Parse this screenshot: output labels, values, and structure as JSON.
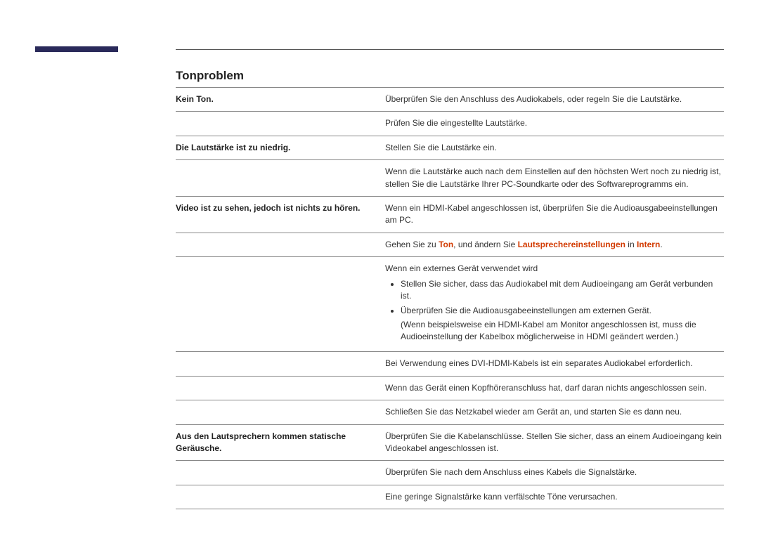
{
  "heading": "Tonproblem",
  "rows": [
    {
      "label": "Kein Ton.",
      "value": "Überprüfen Sie den Anschluss des Audiokabels, oder regeln Sie die Lautstärke."
    },
    {
      "label": "",
      "value": "Prüfen Sie die eingestellte Lautstärke."
    },
    {
      "label": "Die Lautstärke ist zu niedrig.",
      "value": "Stellen Sie die Lautstärke ein."
    },
    {
      "label": "",
      "value": "Wenn die Lautstärke auch nach dem Einstellen auf den höchsten Wert noch zu niedrig ist, stellen Sie die Lautstärke Ihrer PC-Soundkarte oder des Softwareprogramms ein."
    },
    {
      "label": "Video ist zu sehen, jedoch ist nichts zu hören.",
      "value": "Wenn ein HDMI-Kabel angeschlossen ist, überprüfen Sie die Audioausgabeeinstellungen am PC."
    },
    {
      "label": "",
      "rich": {
        "pre": "Gehen Sie zu ",
        "h1": "Ton",
        "mid1": ", und ändern Sie ",
        "h2": "Lautsprechereinstellungen",
        "mid2": " in ",
        "h3": "Intern",
        "post": "."
      }
    },
    {
      "label": "",
      "list_intro": "Wenn ein externes Gerät verwendet wird",
      "items": [
        {
          "text": "Stellen Sie sicher, dass das Audiokabel mit dem Audioeingang am Gerät verbunden ist."
        },
        {
          "text": "Überprüfen Sie die Audioausgabeeinstellungen am externen Gerät.",
          "sub": "(Wenn beispielsweise ein HDMI-Kabel am Monitor angeschlossen ist, muss die Audioeinstellung der Kabelbox möglicherweise in HDMI geändert werden.)"
        }
      ]
    },
    {
      "label": "",
      "value": "Bei Verwendung eines DVI-HDMI-Kabels ist ein separates Audiokabel erforderlich."
    },
    {
      "label": "",
      "value": "Wenn das Gerät einen Kopfhöreranschluss hat, darf daran nichts angeschlossen sein."
    },
    {
      "label": "",
      "value": "Schließen Sie das Netzkabel wieder am Gerät an, und starten Sie es dann neu."
    },
    {
      "label": "Aus den Lautsprechern kommen statische Geräusche.",
      "value": "Überprüfen Sie die Kabelanschlüsse. Stellen Sie sicher, dass an einem Audioeingang kein Videokabel angeschlossen ist."
    },
    {
      "label": "",
      "value": "Überprüfen Sie nach dem Anschluss eines Kabels die Signalstärke."
    },
    {
      "label": "",
      "value": "Eine geringe Signalstärke kann verfälschte Töne verursachen."
    }
  ]
}
